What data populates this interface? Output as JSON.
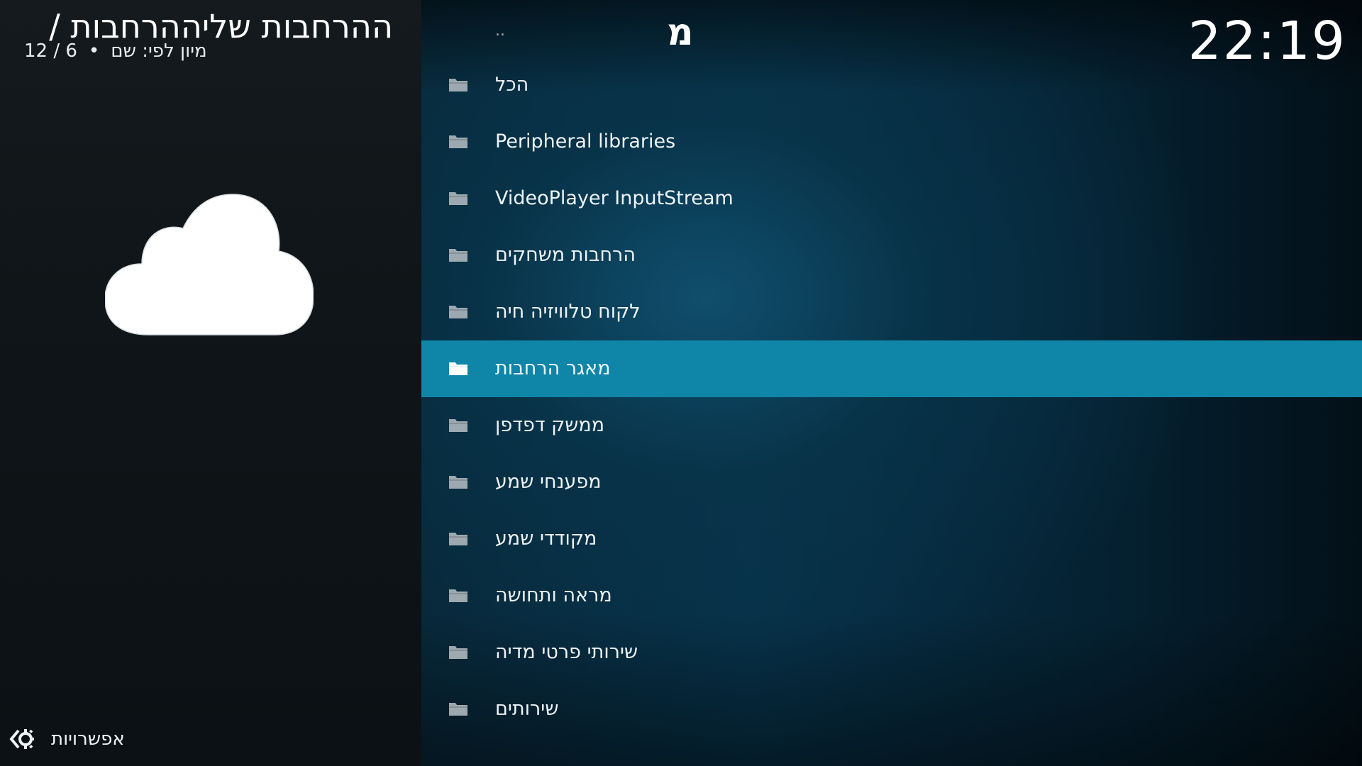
{
  "header": {
    "title": "ההרחבות שליההרחבות /",
    "sort": "מיון לפי: שם",
    "count": "12 / 6",
    "bullet": "•"
  },
  "letter_jump": "מ",
  "clock": "22:19",
  "list": {
    "parent_label": "..",
    "items": [
      {
        "label": "הכל"
      },
      {
        "label": "Peripheral libraries"
      },
      {
        "label": "VideoPlayer InputStream"
      },
      {
        "label": "הרחבות משחקים"
      },
      {
        "label": "לקוח טלוויזיה חיה"
      },
      {
        "label": "מאגר הרחבות",
        "selected": true
      },
      {
        "label": "ממשק דפדפן"
      },
      {
        "label": "מפענחי שמע"
      },
      {
        "label": "מקודדי שמע"
      },
      {
        "label": "מראה ותחושה"
      },
      {
        "label": "שירותי פרטי מדיה"
      },
      {
        "label": "שירותים"
      }
    ]
  },
  "options": {
    "label": "אפשרויות",
    "icon": "options-icon"
  },
  "colors": {
    "selected": "#0f86a8",
    "folder": "#aeb7bc"
  }
}
